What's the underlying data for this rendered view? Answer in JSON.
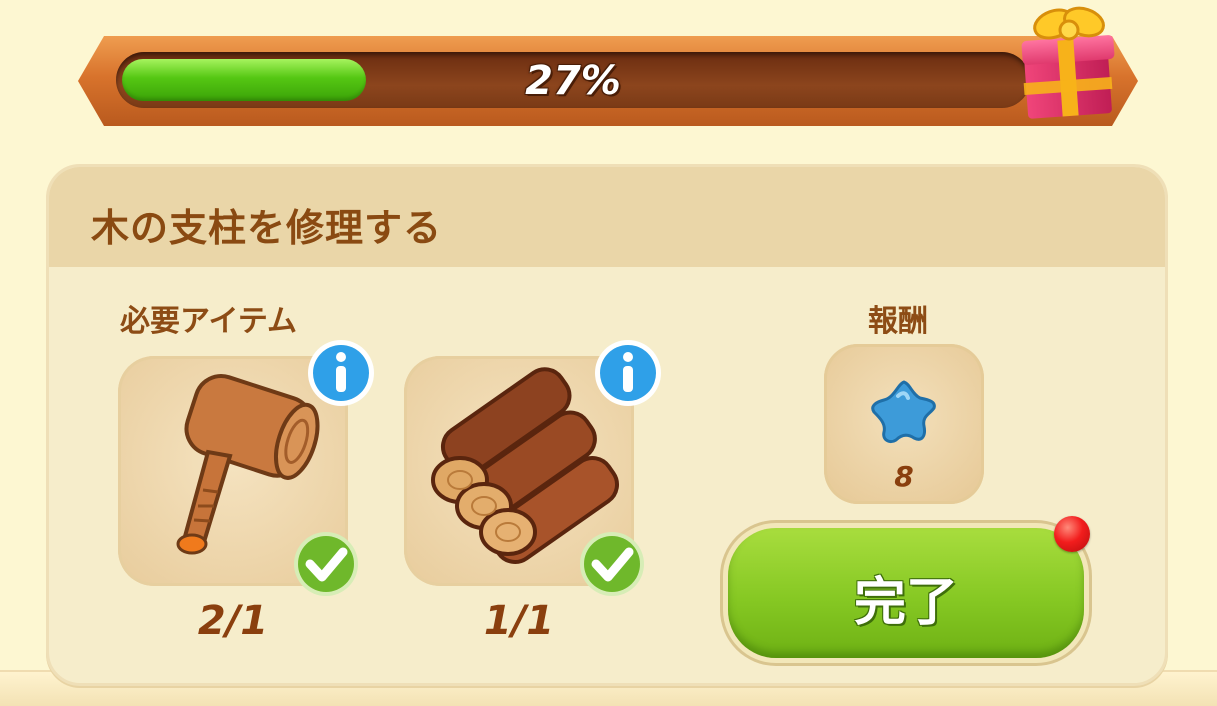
{
  "progress": {
    "fraction": 0.27,
    "label": "27%"
  },
  "task": {
    "title": "木の支柱を修理する"
  },
  "requirements": {
    "label": "必要アイテム",
    "items": [
      {
        "icon": "wooden-mallet-icon",
        "count": "2/1",
        "satisfied": true
      },
      {
        "icon": "log-pile-icon",
        "count": "1/1",
        "satisfied": true
      }
    ]
  },
  "reward": {
    "label": "報酬",
    "icon": "blue-star-icon",
    "amount": "8"
  },
  "complete_button": {
    "label": "完了",
    "has_notification": true
  },
  "colors": {
    "progress_green": "#55c713",
    "button_green": "#86c823",
    "title_brown": "#8a4a12",
    "notification_red": "#f21d1d"
  }
}
